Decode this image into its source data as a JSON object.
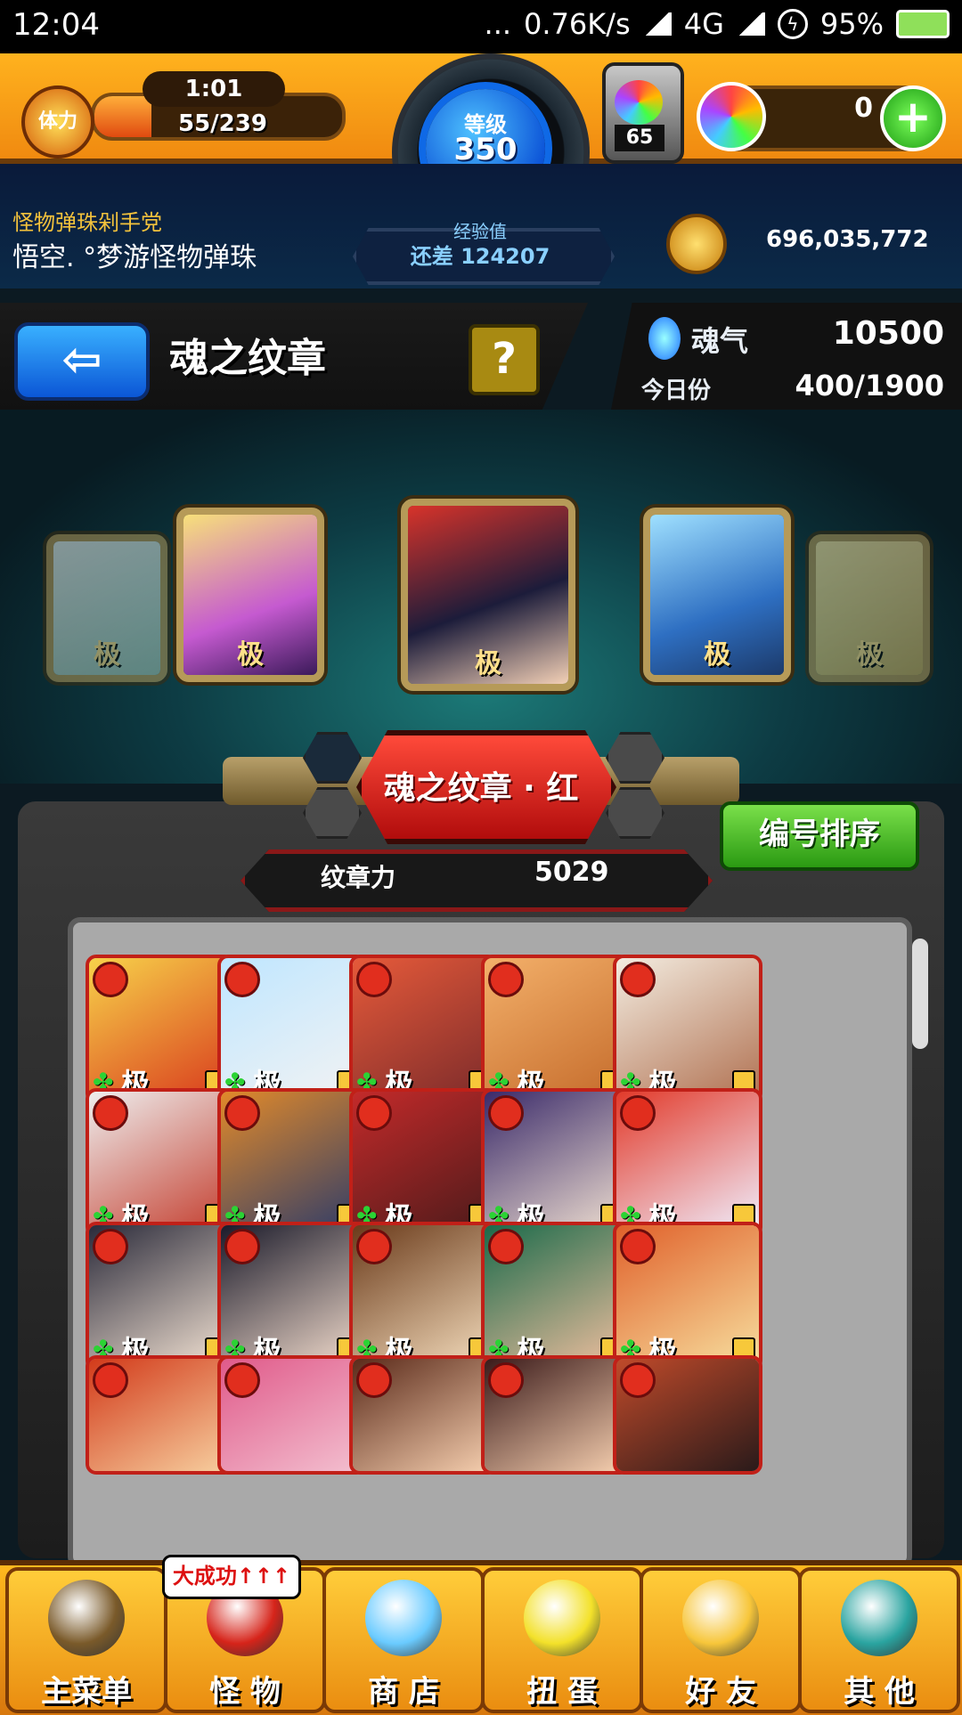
{
  "status_bar": {
    "time": "12:04",
    "dots": "...",
    "speed": "0.76K/s",
    "network": "4G",
    "battery": "95%"
  },
  "stamina": {
    "label": "体力",
    "timer": "1:01",
    "value": "55/239",
    "fill": 0.23
  },
  "level": {
    "label": "等级",
    "value": "350"
  },
  "exp": {
    "label": "经验值",
    "text": "还差 124207"
  },
  "orb_tank": {
    "count": "65"
  },
  "orbs": {
    "value": "0",
    "add": "+"
  },
  "player": {
    "title": "怪物弹珠剁手党",
    "name": "悟空. °梦游怪物弹珠"
  },
  "coins": {
    "value": "696,035,772"
  },
  "header": {
    "back": "⇦",
    "title": "魂之纹章",
    "help": "?"
  },
  "soul": {
    "label": "魂气",
    "value": "10500",
    "today_label": "今日份",
    "today_value": "400/1900"
  },
  "featured": {
    "grade": "极"
  },
  "medal": {
    "name": "魂之纹章 · 红",
    "power_label": "纹章力",
    "power_value": "5029",
    "sort_button": "编号排序"
  },
  "grid": {
    "grade_label": "极",
    "clover": "✤"
  },
  "promo": "大成功↑↑↑",
  "nav": [
    {
      "label": "主菜单",
      "icon": "gate-icon",
      "color": "#7a5a2a"
    },
    {
      "label": "怪 物",
      "icon": "monster-icon",
      "color": "#d6241a"
    },
    {
      "label": "商 店",
      "icon": "orb-icon",
      "color": "#6acbff"
    },
    {
      "label": "扭 蛋",
      "icon": "egg-icon",
      "color": "#f3e12a"
    },
    {
      "label": "好 友",
      "icon": "friends-icon",
      "color": "#f7c63a"
    },
    {
      "label": "其 他",
      "icon": "other-icon",
      "color": "#2aa4a0"
    }
  ]
}
